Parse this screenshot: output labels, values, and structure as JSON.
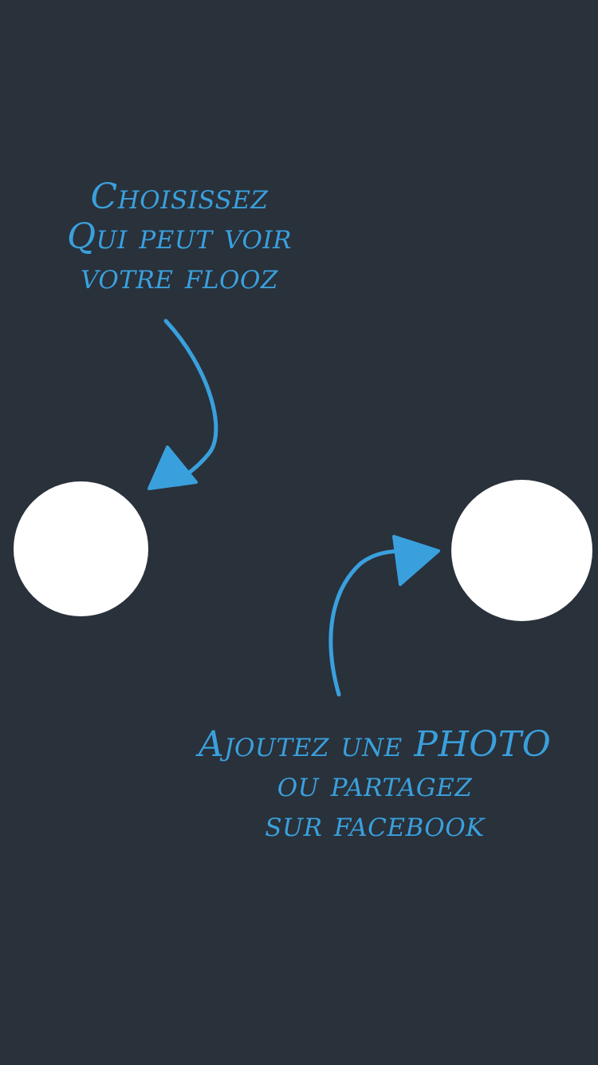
{
  "colors": {
    "background": "#29313b",
    "accent": "#3aa0dd",
    "circle": "#ffffff"
  },
  "tutorial": {
    "visibility_hint": {
      "lines": [
        "Choisissez",
        "Qui peut voir",
        "votre flooz"
      ]
    },
    "photo_hint": {
      "lines": [
        "Ajoutez une PHOTO",
        "ou partagez",
        "sur facebook"
      ]
    },
    "visibility_button": {
      "icon": "circle-highlight-icon"
    },
    "photo_button": {
      "icon": "circle-highlight-icon"
    }
  }
}
